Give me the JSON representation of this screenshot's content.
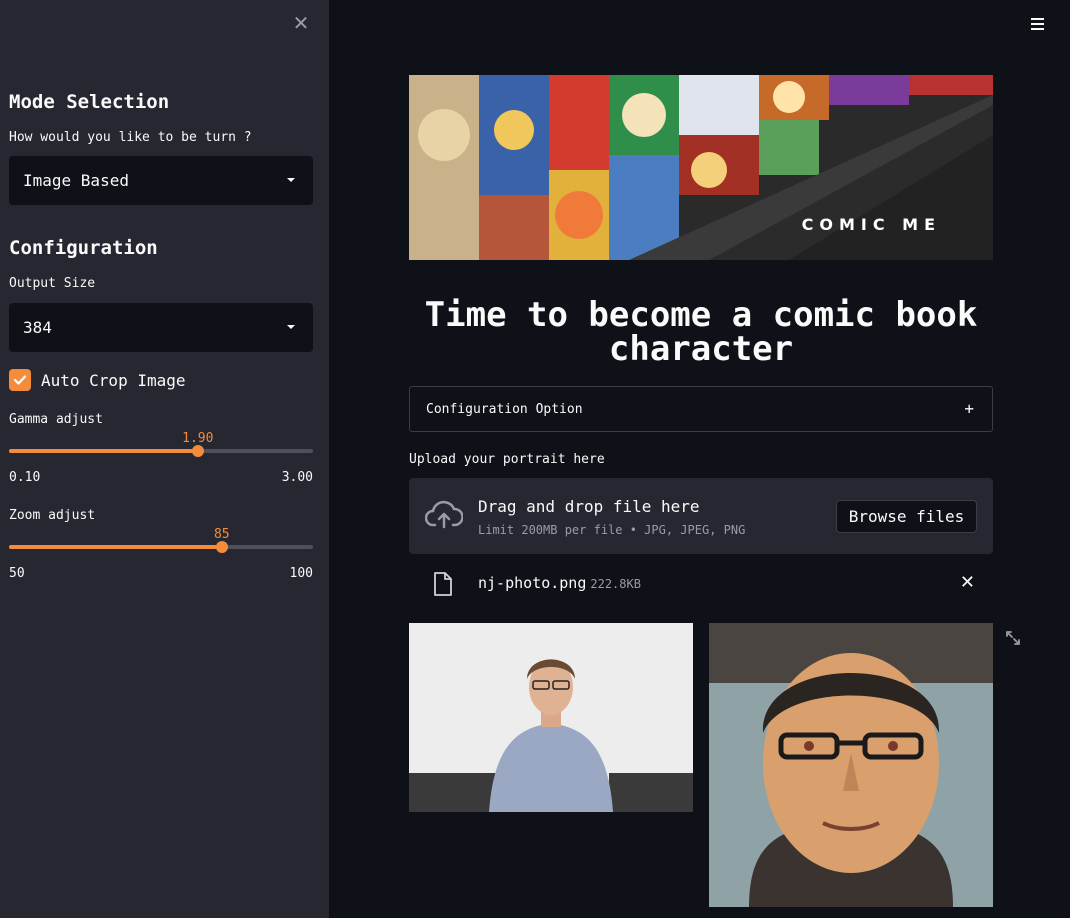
{
  "sidebar": {
    "close_icon": "close-icon",
    "mode_heading": "Mode Selection",
    "mode_question": "How would you like to be turn ?",
    "mode_value": "Image Based",
    "config_heading": "Configuration",
    "output_size_label": "Output Size",
    "output_size_value": "384",
    "auto_crop_label": "Auto Crop Image",
    "auto_crop_checked": true,
    "gamma": {
      "label": "Gamma adjust",
      "value": "1.90",
      "min": "0.10",
      "max": "3.00",
      "fraction": 0.621
    },
    "zoom": {
      "label": "Zoom adjust",
      "value": "85",
      "min": "50",
      "max": "100",
      "fraction": 0.7
    }
  },
  "menu_icon": "hamburger-menu-icon",
  "banner": {
    "text": "COMIC ME"
  },
  "title": "Time to become a comic book character",
  "expander": {
    "label": "Configuration Option",
    "icon": "plus-icon"
  },
  "uploader": {
    "label": "Upload your portrait here",
    "drop_title": "Drag and drop file here",
    "drop_sub": "Limit 200MB per file • JPG, JPEG, PNG",
    "browse_label": "Browse files",
    "icon": "cloud-upload-icon"
  },
  "file": {
    "name": "nj-photo.png",
    "size": "222.8KB",
    "icon": "file-icon"
  },
  "colors": {
    "accent": "#f48c3a",
    "sidebar_bg": "#262730",
    "main_bg": "#0e1117"
  }
}
